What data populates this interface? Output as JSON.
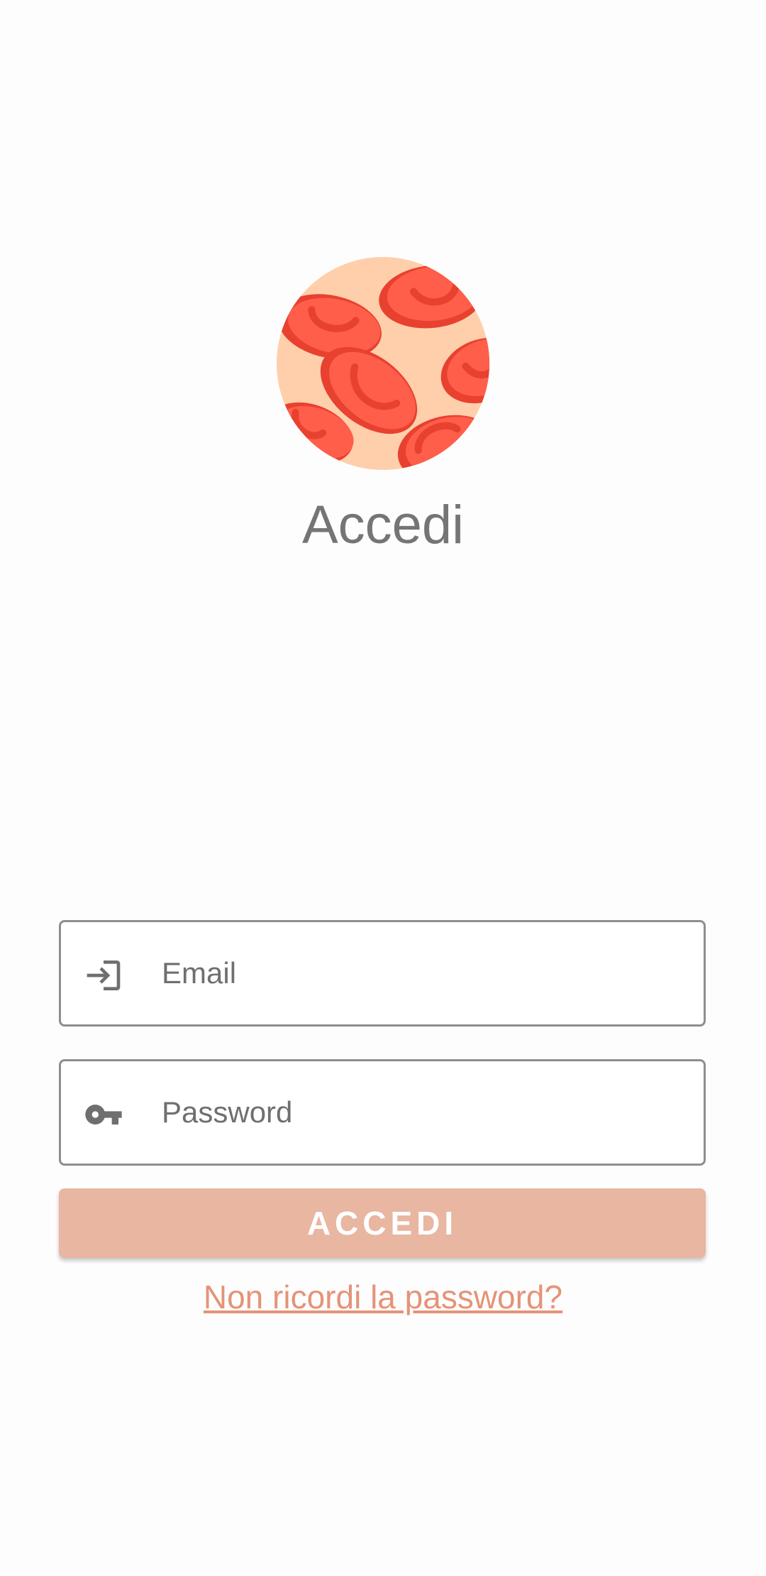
{
  "login": {
    "title": "Accedi",
    "logo": "red-blood-cells-logo",
    "email": {
      "placeholder": "Email",
      "value": "",
      "icon": "login-arrow-icon"
    },
    "password": {
      "placeholder": "Password",
      "value": "",
      "icon": "key-icon"
    },
    "submit_label": "ACCEDI",
    "forgot_password_label": "Non ricordi la password?"
  },
  "colors": {
    "accent": "#e8b6a1",
    "link": "#e59378",
    "logo_background": "#ffcfac",
    "cell_primary": "#ff5e4a",
    "cell_shadow": "#e8412f",
    "text_muted": "#757575"
  }
}
